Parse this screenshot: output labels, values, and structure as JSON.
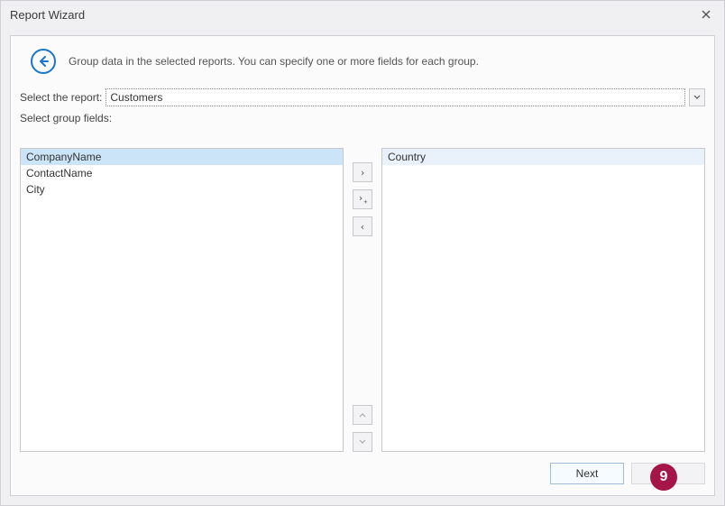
{
  "window": {
    "title": "Report Wizard"
  },
  "header": {
    "description": "Group data in the selected reports. You can specify one or more fields for each group."
  },
  "report_select": {
    "label": "Select the report:",
    "value": "Customers"
  },
  "fields_label": "Select group fields:",
  "available_fields": [
    {
      "label": "CompanyName",
      "selected": true
    },
    {
      "label": "ContactName",
      "selected": false
    },
    {
      "label": "City",
      "selected": false
    }
  ],
  "selected_fields": [
    {
      "label": "Country"
    }
  ],
  "buttons": {
    "next": "Next"
  },
  "badge": "9"
}
